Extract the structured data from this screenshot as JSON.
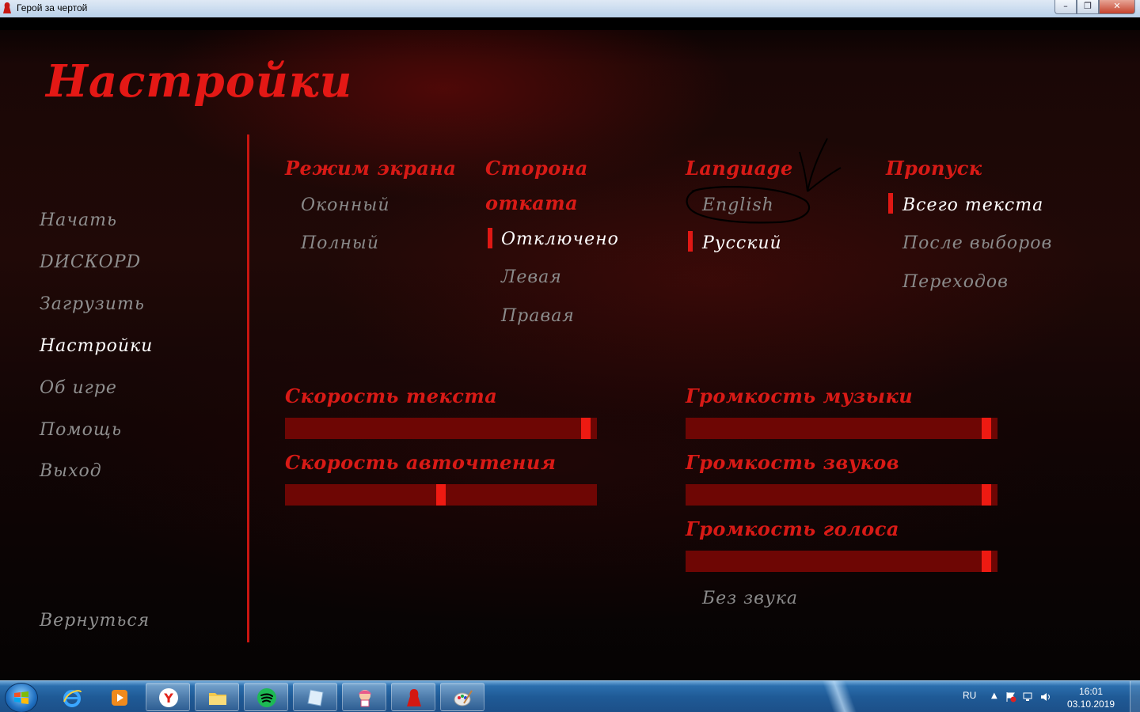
{
  "window": {
    "title": "Герой за чертой",
    "controls": {
      "minimize": "–",
      "maximize": "❐",
      "close": "✕"
    }
  },
  "page": {
    "title": "Настройки"
  },
  "menu": {
    "items": [
      {
        "label": "Начать",
        "active": false
      },
      {
        "label": "DИСКОРD",
        "active": false
      },
      {
        "label": "Загрузить",
        "active": false
      },
      {
        "label": "Настройки",
        "active": true
      },
      {
        "label": "Об игре",
        "active": false
      },
      {
        "label": "Помощь",
        "active": false
      },
      {
        "label": "Выход",
        "active": false
      }
    ],
    "back": "Вернуться"
  },
  "sections": {
    "display": {
      "title": "Режим экрана",
      "options": [
        "Оконный",
        "Полный"
      ]
    },
    "rollback": {
      "title_line1": "Сторона",
      "title_line2": "отката",
      "options": [
        "Отключено",
        "Левая",
        "Правая"
      ],
      "selected": "Отключено"
    },
    "language": {
      "title": "Language",
      "options": [
        "English",
        "Русский"
      ],
      "selected": "Русский"
    },
    "skip": {
      "title": "Пропуск",
      "options": [
        "Всего текста",
        "После выборов",
        "Переходов"
      ],
      "selected": "Всего текста"
    }
  },
  "sliders": {
    "text_speed": {
      "label": "Скорость текста",
      "value": 0.98
    },
    "auto_speed": {
      "label": "Скорость авточтения",
      "value": 0.5
    },
    "music_volume": {
      "label": "Громкость музыки",
      "value": 0.98
    },
    "sound_volume": {
      "label": "Громкость звуков",
      "value": 0.98
    },
    "voice_volume": {
      "label": "Громкость голоса",
      "value": 0.98
    }
  },
  "mute": {
    "label": "Без звука"
  },
  "taskbar": {
    "apps": [
      "internet-explorer",
      "media-player",
      "yandex-browser",
      "file-explorer",
      "spotify",
      "notepad",
      "anime-app",
      "game-app",
      "paint"
    ],
    "language": "RU",
    "time": "16:01",
    "date": "03.10.2019"
  },
  "colors": {
    "accent": "#e41815",
    "slider_track": "#6e0604",
    "slider_knob": "#ee1a12",
    "menu_inactive": "#8f8f8f",
    "selected": "#ffffff"
  }
}
